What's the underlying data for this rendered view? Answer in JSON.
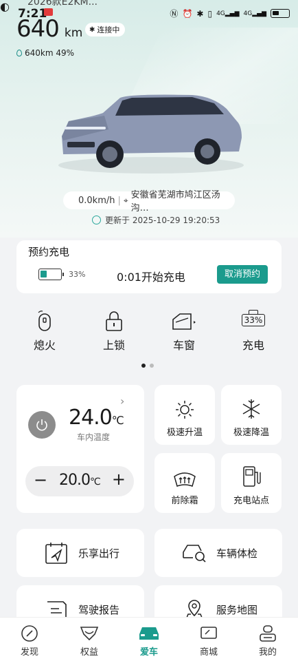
{
  "status_bar": {
    "time": "7:21",
    "cut_text": "2026款E2KM..."
  },
  "vehicle": {
    "range_value": "640",
    "range_unit": "km",
    "connection_status": "连接中",
    "sub_info": "640km 49%",
    "speed": "0.0km/h",
    "location": "安徽省芜湖市鸠江区汤沟…",
    "updated": "更新于 2025-10-29 19:20:53"
  },
  "scheduled_charge": {
    "title": "预约充电",
    "battery_pct": "33%",
    "battery_level": 0.33,
    "start_text": "0:01开始充电",
    "cancel_label": "取消预约"
  },
  "controls": [
    {
      "label": "熄火",
      "icon": "key-fob-icon"
    },
    {
      "label": "上锁",
      "icon": "lock-icon"
    },
    {
      "label": "车窗",
      "icon": "window-icon"
    },
    {
      "label": "充电",
      "icon": "battery-charge-icon",
      "badge": "33%"
    }
  ],
  "climate": {
    "cabin_temp": "24.0",
    "cabin_unit": "℃",
    "cabin_label": "车内温度",
    "set_temp": "20.0",
    "set_unit": "℃",
    "minus": "−",
    "plus": "+"
  },
  "tiles": [
    {
      "label": "极速升温",
      "icon": "sun-icon"
    },
    {
      "label": "极速降温",
      "icon": "snowflake-icon"
    },
    {
      "label": "前除霜",
      "icon": "defrost-icon"
    },
    {
      "label": "充电站点",
      "icon": "charging-station-icon"
    }
  ],
  "services": [
    {
      "label": "乐享出行",
      "icon": "calendar-nav-icon"
    },
    {
      "label": "车辆体检",
      "icon": "car-check-icon"
    },
    {
      "label": "驾驶报告",
      "icon": "report-icon"
    },
    {
      "label": "服务地图",
      "icon": "map-pin-icon"
    }
  ],
  "tabs": [
    {
      "label": "发现",
      "icon": "compass-icon"
    },
    {
      "label": "权益",
      "icon": "gift-icon"
    },
    {
      "label": "爱车",
      "icon": "car-icon",
      "active": true
    },
    {
      "label": "商城",
      "icon": "shop-icon"
    },
    {
      "label": "我的",
      "icon": "profile-icon"
    }
  ],
  "colors": {
    "accent": "#1b9b8d",
    "power_button": "#8c8c8c"
  }
}
